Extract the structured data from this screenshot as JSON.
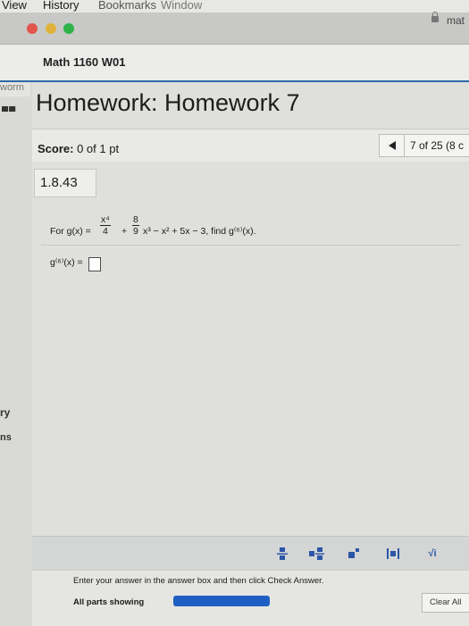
{
  "menubar": {
    "view": "View",
    "history": "History",
    "bookmarks": "Bookmarks",
    "window": "Window"
  },
  "browser": {
    "url_fragment": "mat"
  },
  "course": {
    "title": "Math 1160 W01"
  },
  "sidebar": {
    "worm": "worm",
    "bars": "▄▄",
    "chevron": "›",
    "ry": "ry",
    "ns": "ns"
  },
  "homework": {
    "title": "Homework: Homework 7",
    "score_label": "Score:",
    "score_value": "0 of 1 pt",
    "question_position": "7 of 25 (8 c",
    "problem_id": "1.8.43"
  },
  "question": {
    "prefix": "For g(x) =",
    "frac1_num": "x⁴",
    "frac1_den": "4",
    "plus": "+",
    "frac2_num": "8",
    "frac2_den": "9",
    "rest": "x³ − x² + 5x − 3, find g⁽⁶⁾(x).",
    "answer_label": "g⁽⁶⁾(x) ="
  },
  "toolbar": {
    "tools": [
      "fraction-icon",
      "mixed-number-icon",
      "exponent-icon",
      "absolute-value-icon",
      "sqrt-icon"
    ],
    "sqrt_label": "√i"
  },
  "footer": {
    "instruction": "Enter your answer in the answer box and then click Check Answer.",
    "parts_showing": "All parts showing",
    "progress": 1.0,
    "clear": "Clear All"
  },
  "colors": {
    "accent": "#2b6aa8",
    "progress": "#1f5fc4"
  }
}
